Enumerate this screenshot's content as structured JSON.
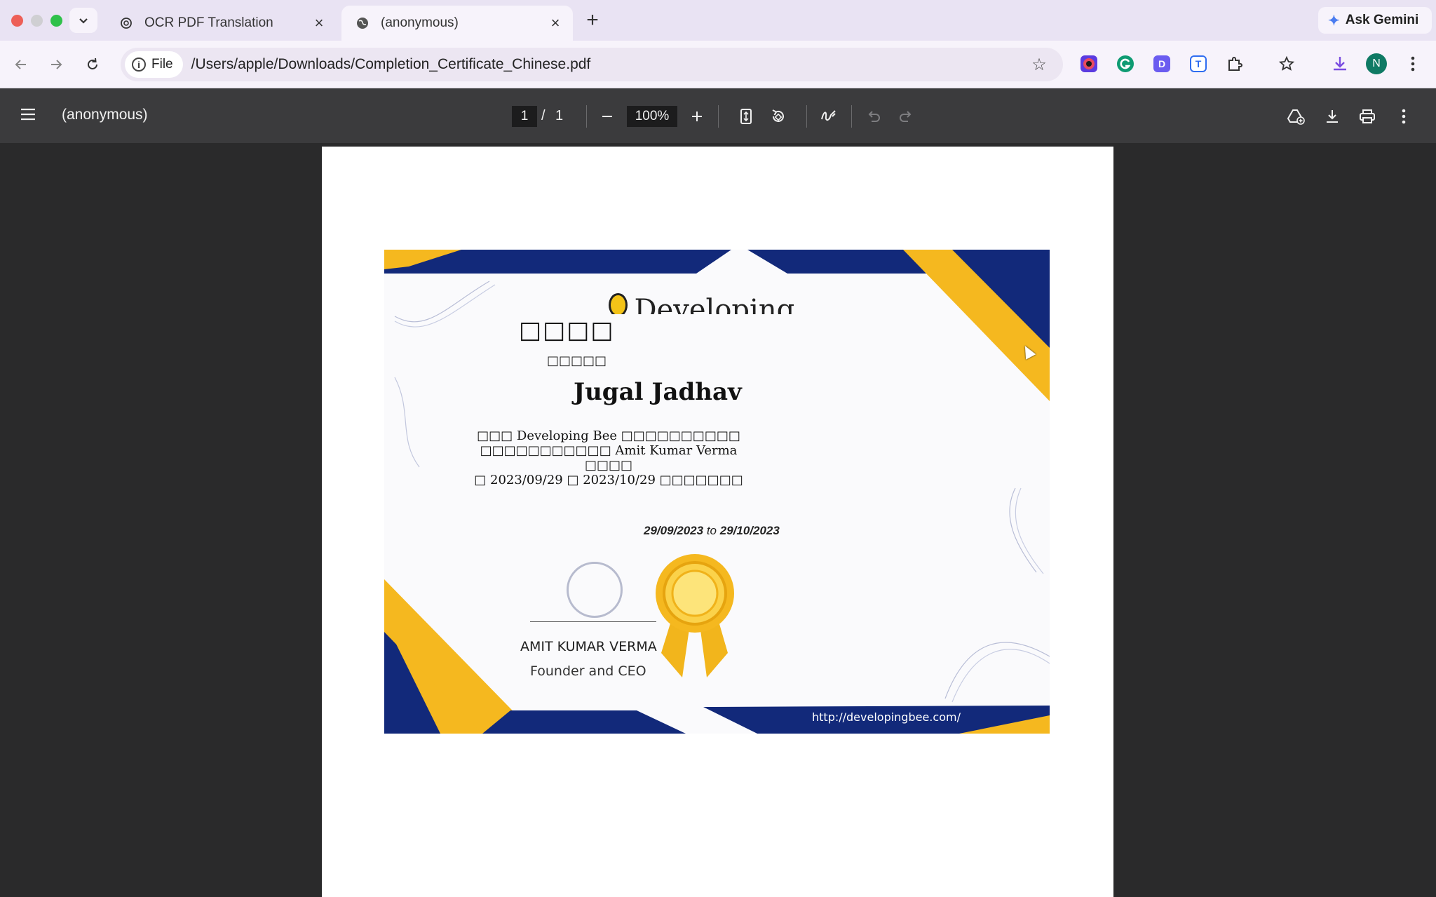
{
  "browser": {
    "tabs": [
      {
        "title": "OCR PDF Translation",
        "favicon": "openai-icon",
        "active": false
      },
      {
        "title": "(anonymous)",
        "favicon": "globe-icon",
        "active": true
      }
    ],
    "gemini_label": "Ask Gemini",
    "address": {
      "chip_label": "File",
      "url": "/Users/apple/Downloads/Completion_Certificate_Chinese.pdf"
    },
    "profile_initial": "N"
  },
  "pdf_viewer": {
    "title": "(anonymous)",
    "current_page": "1",
    "page_separator": "/",
    "total_pages": "1",
    "zoom": "100%"
  },
  "certificate": {
    "logo_text": "Developing Bee",
    "heading": "□□□□",
    "subheading": "□□□□□",
    "recipient": "Jugal Jadhav",
    "body_lines": [
      "□□□ Developing Bee □□□□□□□□□□",
      "□□□□□□□□□□□ Amit Kumar Verma □□□□",
      "□ 2023/09/29 □ 2023/10/29 □□□□□□□"
    ],
    "date_from": "29/09/2023",
    "date_to_word": "to",
    "date_to": "29/10/2023",
    "signer_name": "AMIT KUMAR VERMA",
    "signer_role": "Founder and CEO",
    "website": "http://developingbee.com/",
    "colors": {
      "navy": "#12297a",
      "gold": "#f5b81f"
    }
  }
}
